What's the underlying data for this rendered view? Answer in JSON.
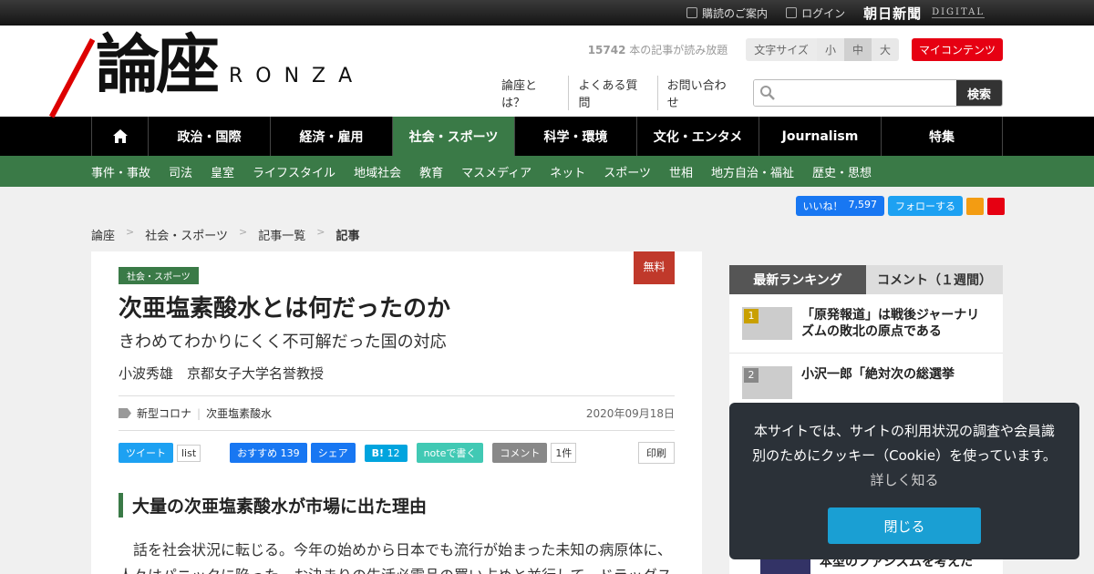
{
  "topbar": {
    "subscribe": "購読のご案内",
    "login": "ログイン",
    "brand": "朝日新聞",
    "digital": "DIGITAL"
  },
  "header": {
    "logo_kanji": "論座",
    "logo_latin": "RONZA",
    "read_count": "15742",
    "read_suffix": "本の記事が読み放題",
    "font_size_label": "文字サイズ",
    "font_small": "小",
    "font_mid": "中",
    "font_large": "大",
    "my_content": "マイコンテンツ",
    "links": [
      "論座とは？",
      "よくある質問",
      "お問い合わせ"
    ],
    "search_button": "検索",
    "search_placeholder": ""
  },
  "nav": {
    "items": [
      "政治・国際",
      "経済・雇用",
      "社会・スポーツ",
      "科学・環境",
      "文化・エンタメ",
      "Journalism",
      "特集"
    ]
  },
  "subnav": {
    "items": [
      "事件・事故",
      "司法",
      "皇室",
      "ライフスタイル",
      "地域社会",
      "教育",
      "マスメディア",
      "ネット",
      "スポーツ",
      "世相",
      "地方自治・福祉",
      "歴史・思想"
    ]
  },
  "social": {
    "like": "いいね！",
    "like_count": "7,597",
    "follow": "フォローする"
  },
  "breadcrumb": {
    "items": [
      "論座",
      "社会・スポーツ",
      "記事一覧"
    ],
    "sep": ">",
    "current": "記事"
  },
  "article": {
    "category": "社会・スポーツ",
    "free": "無料",
    "title": "次亜塩素酸水とは何だったのか",
    "subtitle": "きわめてわかりにくく不可解だった国の対応",
    "author": "小波秀雄　京都女子大学名誉教授",
    "tags": [
      "新型コロナ",
      "次亜塩素酸水"
    ],
    "date": "2020年09月18日",
    "share": {
      "tweet": "ツイート",
      "list": "list",
      "fb": "おすすめ",
      "fb_count": "139",
      "fb_share": "シェア",
      "hatena": "B!",
      "hatena_count": "12",
      "note": "noteで書く",
      "comment": "コメント",
      "comment_count": "1件",
      "print": "印刷"
    },
    "heading": "大量の次亜塩素酸水が市場に出た理由",
    "body": "話を社会状況に転じる。今年の始めから日本でも流行が始まった未知の病原体に、人々はパニックに陥った。お決まりの生活必需品の買い占めと並行して、ドラッグス"
  },
  "ranking": {
    "tab_latest": "最新ランキング",
    "tab_comment": "コメント（１週間）",
    "items": [
      {
        "num": "1",
        "title": "「原発報道」は戦後ジャーナリズムの敗北の原点である"
      },
      {
        "num": "2",
        "title": "小沢一郎「絶対次の総選挙"
      }
    ],
    "bottom_title": "本型のファシズムを考えた"
  },
  "cookie": {
    "text": "本サイトでは、サイトの利用状況の調査や会員識別のためにクッキー（Cookie）を使っています。",
    "more": "詳しく知る",
    "close": "閉じる"
  }
}
